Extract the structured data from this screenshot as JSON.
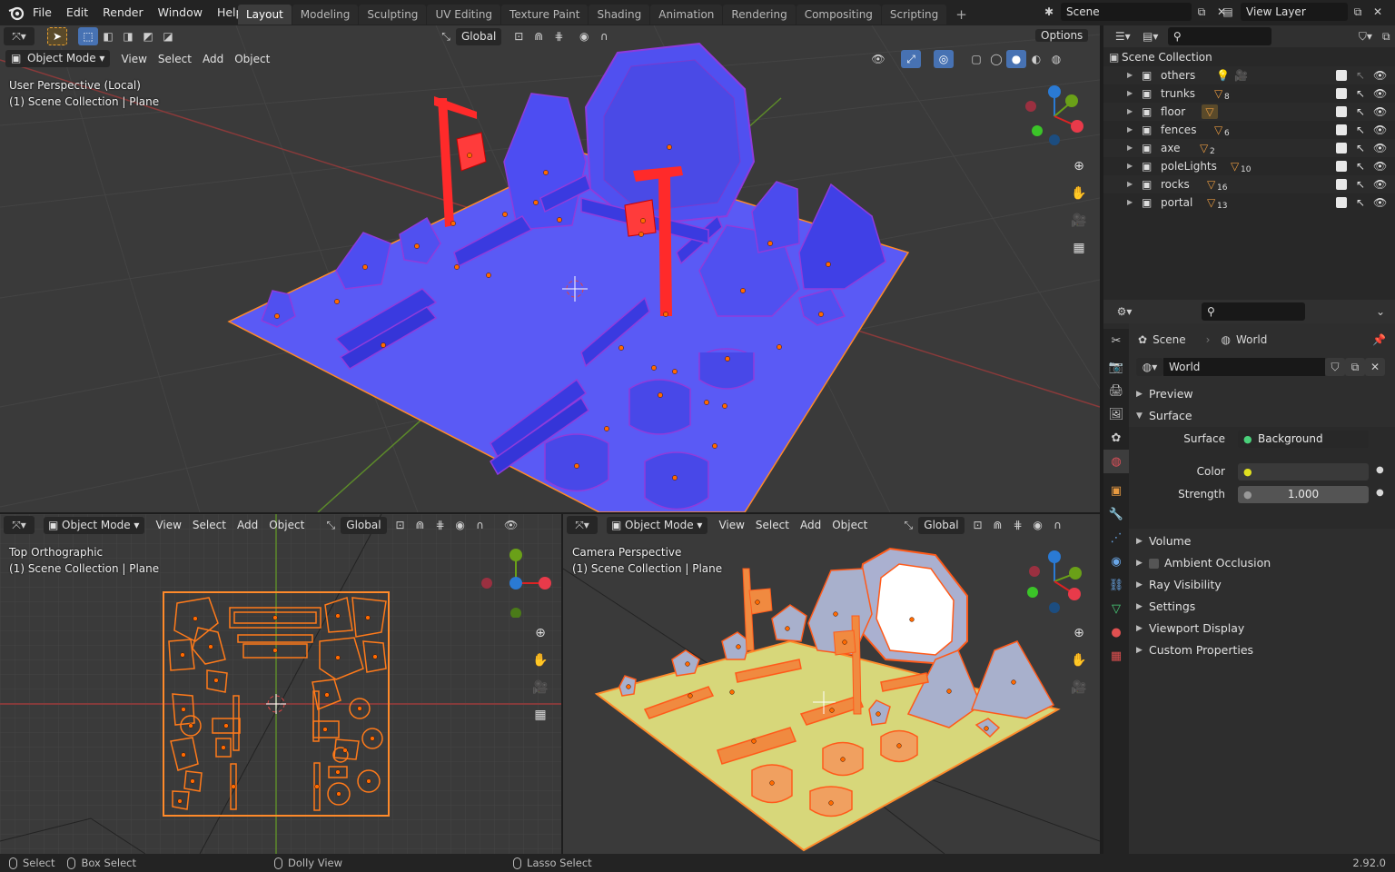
{
  "topbar": {
    "menus": [
      "File",
      "Edit",
      "Render",
      "Window",
      "Help"
    ],
    "workspaces": [
      "Layout",
      "Modeling",
      "Sculpting",
      "UV Editing",
      "Texture Paint",
      "Shading",
      "Animation",
      "Rendering",
      "Compositing",
      "Scripting"
    ],
    "active_workspace": "Layout",
    "scene_name": "Scene",
    "view_layer": "View Layer"
  },
  "main_viewport": {
    "mode": "Object Mode",
    "menus": [
      "View",
      "Select",
      "Add",
      "Object"
    ],
    "transform_orientation": "Global",
    "options_label": "Options",
    "view_name": "User Perspective (Local)",
    "collection_info": "(1) Scene Collection | Plane"
  },
  "left_viewport": {
    "mode": "Object Mode",
    "menus": [
      "View",
      "Select",
      "Add",
      "Object"
    ],
    "transform_orientation": "Global",
    "view_name": "Top Orthographic",
    "collection_info": "(1) Scene Collection | Plane"
  },
  "right_viewport": {
    "mode": "Object Mode",
    "menus": [
      "View",
      "Select",
      "Add",
      "Object"
    ],
    "transform_orientation": "Global",
    "view_name": "Camera Perspective",
    "collection_info": "(1) Scene Collection | Plane"
  },
  "outliner": {
    "root": "Scene Collection",
    "items": [
      {
        "name": "others",
        "count": ""
      },
      {
        "name": "trunks",
        "count": "8"
      },
      {
        "name": "floor",
        "count": ""
      },
      {
        "name": "fences",
        "count": "6"
      },
      {
        "name": "axe",
        "count": "2"
      },
      {
        "name": "poleLights",
        "count": "10"
      },
      {
        "name": "rocks",
        "count": "16"
      },
      {
        "name": "portal",
        "count": "13"
      }
    ]
  },
  "properties": {
    "breadcrumb_scene": "Scene",
    "breadcrumb_world": "World",
    "world_name": "World",
    "panels": {
      "preview": "Preview",
      "surface": "Surface",
      "volume": "Volume",
      "ambient_occlusion": "Ambient Occlusion",
      "ray_visibility": "Ray Visibility",
      "settings": "Settings",
      "viewport_display": "Viewport Display",
      "custom_properties": "Custom Properties"
    },
    "surface_label": "Surface",
    "surface_value": "Background",
    "color_label": "Color",
    "strength_label": "Strength",
    "strength_value": "1.000"
  },
  "statusbar": {
    "select": "Select",
    "box_select": "Box Select",
    "dolly_view": "Dolly View",
    "lasso_select": "Lasso Select",
    "version": "2.92.0"
  },
  "colors": {
    "accent": "#4772b3",
    "selected_orange": "#ff8a2a",
    "active_red": "#ff2a2a",
    "mesh_blue": "#5555ff",
    "grid_bg": "#3a3a3a"
  }
}
